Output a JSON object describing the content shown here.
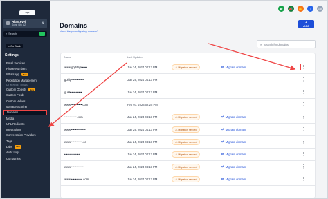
{
  "sidebar": {
    "logo": "logo",
    "account": {
      "name": "HighLevel",
      "location": "Some City, AZ"
    },
    "search": {
      "placeholder": "Search",
      "shortcut": "ctrl K"
    },
    "go_back": "Go Back",
    "settings": "Settings",
    "items": [
      {
        "label": "Email Services"
      },
      {
        "label": "Phone Numbers"
      },
      {
        "label": "WhatsApp",
        "badge": "New"
      },
      {
        "label": "Reputation Management"
      },
      {
        "section": "OTHER SETTINGS"
      },
      {
        "label": "Custom Objects",
        "badge": "New"
      },
      {
        "label": "Custom Fields"
      },
      {
        "label": "Custom Values"
      },
      {
        "label": "Manage Scoring"
      },
      {
        "label": "Domains",
        "active": true
      },
      {
        "label": "Media"
      },
      {
        "label": "URL Redirects"
      },
      {
        "label": "Integrations"
      },
      {
        "label": "Conversation Providers"
      },
      {
        "label": "Tags"
      },
      {
        "label": "Labs",
        "badge": "New"
      },
      {
        "label": "Audit Logs"
      },
      {
        "label": "Companies"
      }
    ]
  },
  "topbar": {
    "icons": [
      {
        "name": "phone-icon",
        "color": "#16a34a"
      },
      {
        "name": "megaphone-icon",
        "color": "#15803d"
      },
      {
        "name": "bell-icon",
        "color": "#f97316"
      },
      {
        "name": "help-icon",
        "color": "#2563eb"
      },
      {
        "name": "avatar-icon",
        "color": "#94a3b8",
        "text": "GA"
      }
    ]
  },
  "main": {
    "title": "Domains",
    "help_link": "Need Help configuring domain?",
    "add_button": "+ Add",
    "search_placeholder": "Search for domains",
    "table": {
      "headers": {
        "name": "Name",
        "last_updated": "Last Updated"
      },
      "rows": [
        {
          "domain": "www.ghjfdsgk•••••",
          "date": "Jun 24, 2024 04:13 PM",
          "status": "Migration needed",
          "action": "Migrate domain",
          "highlighted": true
        },
        {
          "domain": "gohig••••••••••••",
          "date": "Jun 24, 2024 04:13 PM",
          "status": "",
          "action": "",
          "highlighted": false
        },
        {
          "domain": "gusl••••••••••••",
          "date": "Jun 24, 2024 04:13 PM",
          "status": "",
          "action": "",
          "highlighted": false
        },
        {
          "domain": "www•••••••••••.com",
          "date": "Feb 07, 2024 02:25 PM",
          "status": "",
          "action": "",
          "highlighted": false
        },
        {
          "domain": "••••••••••••.com",
          "date": "Jun 24, 2024 04:13 PM",
          "status": "Migration needed",
          "action": "Migrate domain",
          "highlighted": false
        },
        {
          "domain": "www.••••••••••••••",
          "date": "Jun 24, 2024 04:13 PM",
          "status": "Migration needed",
          "action": "Migrate domain",
          "highlighted": false
        },
        {
          "domain": "www.•••••••••••.co",
          "date": "Jun 24, 2024 04:13 PM",
          "status": "Migration needed",
          "action": "Migrate domain",
          "highlighted": false
        },
        {
          "domain": "•••••••••••••••",
          "date": "Jun 24, 2024 04:13 PM",
          "status": "Migration needed",
          "action": "Migrate domain",
          "highlighted": false
        },
        {
          "domain": "www.••••••••••••",
          "date": "Jun 24, 2024 04:13 PM",
          "status": "Migration needed",
          "action": "Migrate domain",
          "highlighted": false
        },
        {
          "domain": "www.•••••••••••.com",
          "date": "Jun 24, 2024 04:13 PM",
          "status": "Migration needed",
          "action": "Migrate domain",
          "highlighted": false
        }
      ]
    }
  },
  "annotation": {
    "color": "#ef4444"
  }
}
